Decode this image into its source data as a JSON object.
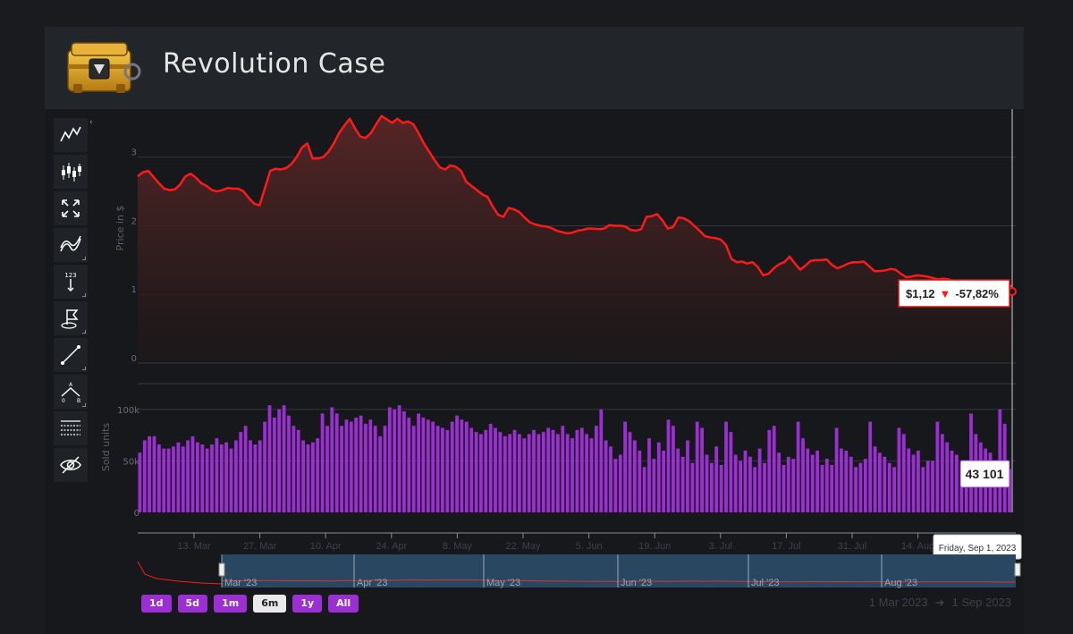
{
  "header": {
    "title": "Revolution Case",
    "case_image": "weapon-case-icon"
  },
  "toolbar": [
    {
      "name": "line-chart-icon"
    },
    {
      "name": "candlestick-icon"
    },
    {
      "name": "fullscreen-icon"
    },
    {
      "name": "indicators-icon"
    },
    {
      "name": "price-label-icon",
      "label": "123"
    },
    {
      "name": "flag-annotation-icon"
    },
    {
      "name": "draw-line-icon"
    },
    {
      "name": "measure-icon",
      "labels": [
        "A",
        "0",
        "B"
      ]
    },
    {
      "name": "grid-icon"
    },
    {
      "name": "hide-icon"
    }
  ],
  "range_buttons": [
    {
      "label": "1d",
      "active": false
    },
    {
      "label": "5d",
      "active": false
    },
    {
      "label": "1m",
      "active": false
    },
    {
      "label": "6m",
      "active": true
    },
    {
      "label": "1y",
      "active": false
    },
    {
      "label": "All",
      "active": false
    }
  ],
  "date_range": {
    "from": "1 Mar 2023",
    "arrow": "➜",
    "to": "1 Sep 2023"
  },
  "colors": {
    "price_line": "#ff1a1a",
    "volume_bar": "#9b2fd2",
    "navigator_fill": "#2b4a66",
    "button": "#9b2fd2"
  },
  "chart_data": {
    "type": "line",
    "price": {
      "ylabel": "Price in $",
      "yticks": [
        "0",
        "1",
        "2",
        "3"
      ],
      "ylim": [
        0,
        3.7
      ],
      "values": [
        2.72,
        2.78,
        2.8,
        2.71,
        2.62,
        2.54,
        2.52,
        2.53,
        2.6,
        2.72,
        2.76,
        2.7,
        2.62,
        2.58,
        2.52,
        2.5,
        2.52,
        2.55,
        2.54,
        2.54,
        2.5,
        2.4,
        2.32,
        2.3,
        2.55,
        2.8,
        2.83,
        2.82,
        2.84,
        2.9,
        3.0,
        3.14,
        3.2,
        2.98,
        2.98,
        3.0,
        3.08,
        3.2,
        3.35,
        3.46,
        3.56,
        3.42,
        3.3,
        3.28,
        3.35,
        3.48,
        3.6,
        3.55,
        3.5,
        3.56,
        3.5,
        3.52,
        3.48,
        3.35,
        3.2,
        3.08,
        2.96,
        2.85,
        2.82,
        2.88,
        2.86,
        2.8,
        2.64,
        2.58,
        2.52,
        2.46,
        2.42,
        2.28,
        2.16,
        2.13,
        2.26,
        2.24,
        2.2,
        2.12,
        2.05,
        2.02,
        2.0,
        1.99,
        1.97,
        1.93,
        1.91,
        1.89,
        1.9,
        1.93,
        1.94,
        1.96,
        1.96,
        1.95,
        1.96,
        2.01,
        2.0,
        2.0,
        1.99,
        1.94,
        1.93,
        1.95,
        2.13,
        2.14,
        2.17,
        2.08,
        1.96,
        1.98,
        2.12,
        2.11,
        2.07,
        2.0,
        1.93,
        1.85,
        1.83,
        1.82,
        1.8,
        1.72,
        1.52,
        1.47,
        1.48,
        1.45,
        1.47,
        1.4,
        1.28,
        1.3,
        1.38,
        1.44,
        1.47,
        1.55,
        1.45,
        1.36,
        1.42,
        1.49,
        1.5,
        1.5,
        1.51,
        1.43,
        1.38,
        1.41,
        1.45,
        1.47,
        1.47,
        1.48,
        1.41,
        1.34,
        1.34,
        1.35,
        1.37,
        1.36,
        1.3,
        1.25,
        1.26,
        1.28,
        1.27,
        1.26,
        1.24,
        1.22,
        1.23,
        1.22,
        1.2,
        1.18,
        1.19,
        1.16,
        1.17,
        1.16,
        1.18,
        1.15,
        1.14,
        1.13,
        1.13,
        1.12
      ],
      "last_label": "$1,12",
      "change_symbol": "▼",
      "change_label": "-57,82%"
    },
    "volume": {
      "ylabel": "Sold units",
      "yticks": [
        "0",
        "50k",
        "100k"
      ],
      "ylim": [
        0,
        125000
      ],
      "values": [
        58000,
        70000,
        74000,
        74000,
        66000,
        62000,
        62000,
        64000,
        68000,
        64000,
        70000,
        74000,
        68000,
        66000,
        62000,
        66000,
        72000,
        66000,
        68000,
        62000,
        70000,
        78000,
        84000,
        70000,
        66000,
        70000,
        88000,
        104000,
        92000,
        100000,
        104000,
        94000,
        84000,
        80000,
        70000,
        66000,
        68000,
        72000,
        96000,
        84000,
        102000,
        96000,
        84000,
        90000,
        88000,
        92000,
        94000,
        86000,
        90000,
        84000,
        74000,
        84000,
        102000,
        100000,
        104000,
        98000,
        92000,
        84000,
        96000,
        92000,
        90000,
        88000,
        84000,
        82000,
        80000,
        88000,
        94000,
        90000,
        88000,
        82000,
        78000,
        76000,
        80000,
        86000,
        82000,
        78000,
        74000,
        76000,
        80000,
        76000,
        72000,
        76000,
        80000,
        76000,
        78000,
        82000,
        80000,
        76000,
        84000,
        76000,
        72000,
        80000,
        82000,
        76000,
        72000,
        84000,
        100000,
        70000,
        64000,
        52000,
        56000,
        88000,
        78000,
        70000,
        60000,
        44000,
        72000,
        52000,
        68000,
        60000,
        90000,
        84000,
        62000,
        54000,
        70000,
        48000,
        88000,
        82000,
        56000,
        48000,
        64000,
        46000,
        88000,
        78000,
        56000,
        50000,
        60000,
        54000,
        44000,
        62000,
        48000,
        80000,
        84000,
        58000,
        46000,
        54000,
        52000,
        88000,
        72000,
        62000,
        56000,
        60000,
        46000,
        52000,
        46000,
        82000,
        62000,
        60000,
        54000,
        44000,
        48000,
        52000,
        88000,
        64000,
        58000,
        54000,
        48000,
        44000,
        82000,
        76000,
        62000,
        56000,
        60000,
        44000,
        50000,
        50000,
        88000,
        76000,
        68000,
        60000,
        56000,
        46000,
        50000,
        96000,
        76000,
        68000,
        62000,
        58000,
        48000,
        100000,
        86000,
        42000
      ],
      "last_label": "43 101"
    },
    "x_ticks": [
      "13. Mar",
      "27. Mar",
      "10. Apr",
      "24. Apr",
      "8. May",
      "22. May",
      "5. Jun",
      "19. Jun",
      "3. Jul",
      "17. Jul",
      "31. Jul",
      "14. Aug"
    ],
    "tooltip_date": "Friday, Sep 1, 2023",
    "navigator_labels": [
      "Mar '23",
      "Apr '23",
      "May '23",
      "Jun '23",
      "Jul '23",
      "Aug '23"
    ]
  }
}
